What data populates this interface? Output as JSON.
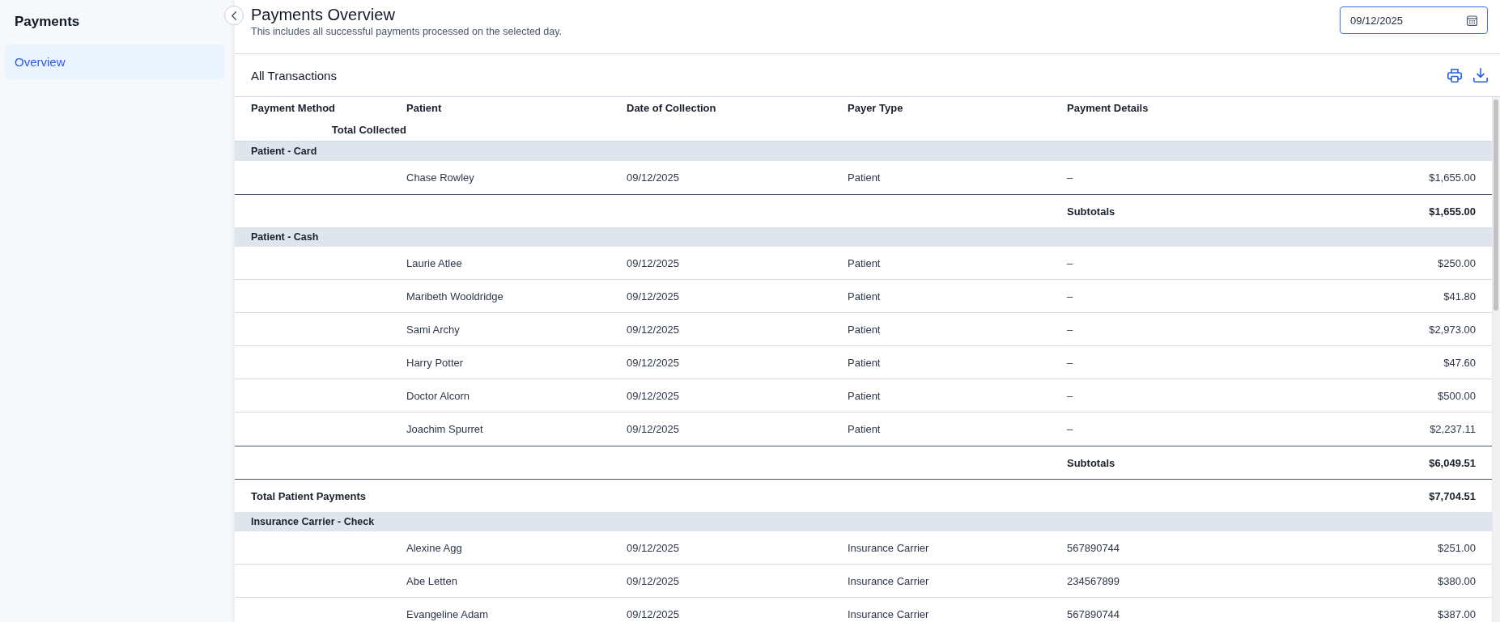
{
  "sidebar": {
    "title": "Payments",
    "items": [
      {
        "label": "Overview",
        "selected": true
      }
    ]
  },
  "header": {
    "title": "Payments Overview",
    "subtitle": "This includes all successful payments processed on the selected day.",
    "date_field": {
      "value": "09/12/2025"
    }
  },
  "transactions": {
    "title": "All Transactions",
    "columns": [
      "Payment Method",
      "Patient",
      "Date of Collection",
      "Payer Type",
      "Payment Details",
      "Total Collected"
    ],
    "rows": [
      {
        "kind": "group",
        "label": "Patient - Card"
      },
      {
        "kind": "payment",
        "patient": "Chase Rowley",
        "date": "09/12/2025",
        "payer_type": "Patient",
        "details": "–",
        "total": "$1,655.00"
      },
      {
        "kind": "subtotal",
        "label": "Subtotals",
        "total": "$1,655.00"
      },
      {
        "kind": "group",
        "label": "Patient - Cash"
      },
      {
        "kind": "payment",
        "patient": "Laurie Atlee",
        "date": "09/12/2025",
        "payer_type": "Patient",
        "details": "–",
        "total": "$250.00"
      },
      {
        "kind": "payment",
        "patient": "Maribeth Wooldridge",
        "date": "09/12/2025",
        "payer_type": "Patient",
        "details": "–",
        "total": "$41.80"
      },
      {
        "kind": "payment",
        "patient": "Sami Archy",
        "date": "09/12/2025",
        "payer_type": "Patient",
        "details": "–",
        "total": "$2,973.00"
      },
      {
        "kind": "payment",
        "patient": "Harry Potter",
        "date": "09/12/2025",
        "payer_type": "Patient",
        "details": "–",
        "total": "$47.60"
      },
      {
        "kind": "payment",
        "patient": "Doctor Alcorn",
        "date": "09/12/2025",
        "payer_type": "Patient",
        "details": "–",
        "total": "$500.00"
      },
      {
        "kind": "payment",
        "patient": "Joachim Spurret",
        "date": "09/12/2025",
        "payer_type": "Patient",
        "details": "–",
        "total": "$2,237.11"
      },
      {
        "kind": "subtotal",
        "label": "Subtotals",
        "total": "$6,049.51"
      },
      {
        "kind": "total",
        "label": "Total Patient Payments",
        "total": "$7,704.51"
      },
      {
        "kind": "group",
        "label": "Insurance Carrier - Check"
      },
      {
        "kind": "payment",
        "patient": "Alexine Agg",
        "date": "09/12/2025",
        "payer_type": "Insurance Carrier",
        "details": "567890744",
        "total": "$251.00"
      },
      {
        "kind": "payment",
        "patient": "Abe Letten",
        "date": "09/12/2025",
        "payer_type": "Insurance Carrier",
        "details": "234567899",
        "total": "$380.00"
      },
      {
        "kind": "payment",
        "patient": "Evangeline Adam",
        "date": "09/12/2025",
        "payer_type": "Insurance Carrier",
        "details": "567890744",
        "total": "$387.00"
      }
    ]
  }
}
